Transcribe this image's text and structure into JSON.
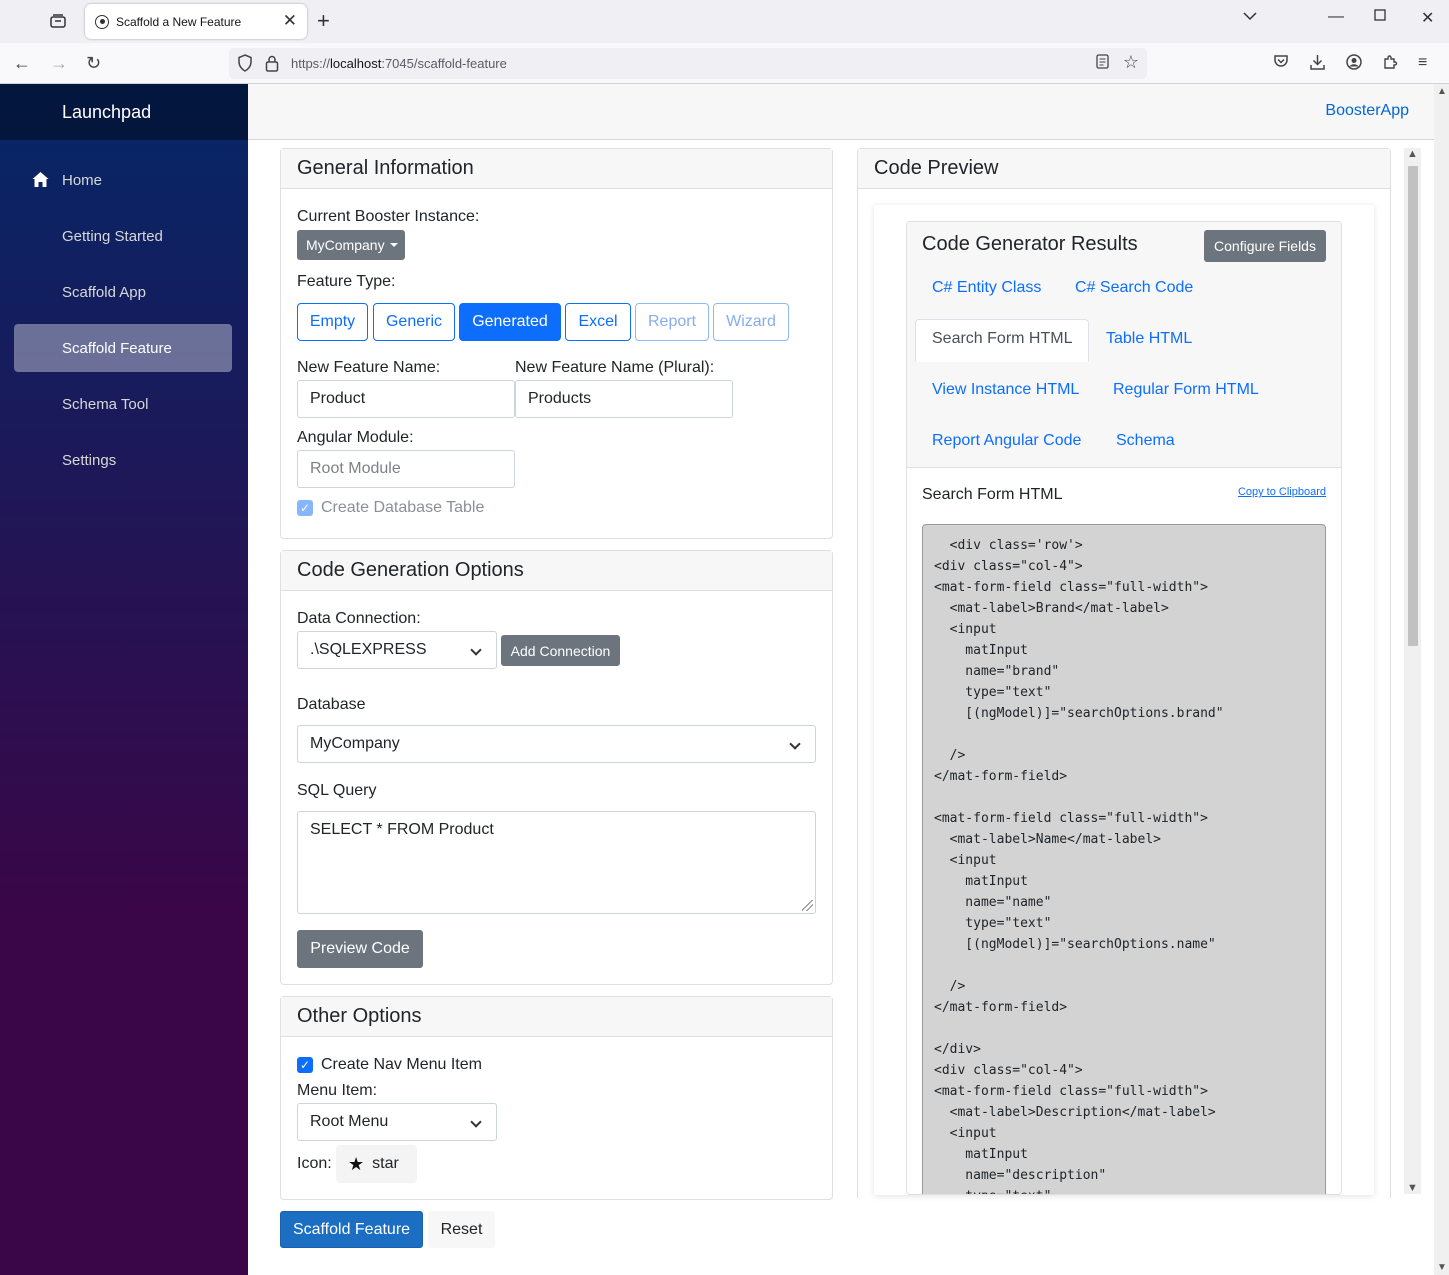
{
  "browser": {
    "tab_title": "Scaffold a New Feature",
    "url_prefix": "https://",
    "url_host": "localhost",
    "url_rest": ":7045/scaffold-feature"
  },
  "sidebar": {
    "brand": "Launchpad",
    "items": [
      {
        "label": "Home",
        "icon": "home-icon"
      },
      {
        "label": "Getting Started"
      },
      {
        "label": "Scaffold App"
      },
      {
        "label": "Scaffold Feature",
        "active": true
      },
      {
        "label": "Schema Tool"
      },
      {
        "label": "Settings"
      }
    ]
  },
  "top_row": {
    "brand_link": "BoosterApp"
  },
  "general": {
    "header": "General Information",
    "instance_label": "Current Booster Instance:",
    "instance_value": "MyCompany",
    "feature_type_label": "Feature Type:",
    "feature_types": [
      "Empty",
      "Generic",
      "Generated",
      "Excel",
      "Report",
      "Wizard"
    ],
    "selected_feature_type": "Generated",
    "name_label": "New Feature Name:",
    "name_value": "Product",
    "plural_label": "New Feature Name (Plural):",
    "plural_value": "Products",
    "module_label": "Angular Module:",
    "module_placeholder": "Root Module",
    "create_table_label": "Create Database Table",
    "create_table_checked": true
  },
  "codegen": {
    "header": "Code Generation Options",
    "connection_label": "Data Connection:",
    "connection_value": ".\\SQLEXPRESS",
    "add_connection": "Add Connection",
    "database_label": "Database",
    "database_value": "MyCompany",
    "sql_label": "SQL Query",
    "sql_value": "SELECT * FROM Product",
    "preview_button": "Preview Code"
  },
  "other": {
    "header": "Other Options",
    "nav_item_label": "Create Nav Menu Item",
    "nav_item_checked": true,
    "menu_item_label": "Menu Item:",
    "menu_item_value": "Root Menu",
    "icon_label": "Icon:",
    "icon_value": "star",
    "icon_glyph": "star-icon"
  },
  "actions": {
    "scaffold": "Scaffold Feature",
    "reset": "Reset"
  },
  "preview": {
    "header": "Code Preview",
    "results_title": "Code Generator Results",
    "configure_fields": "Configure Fields",
    "tabs": [
      "C# Entity Class",
      "C# Search Code",
      "Search Form HTML",
      "Table HTML",
      "View Instance HTML",
      "Regular Form HTML",
      "Report Angular Code",
      "Schema"
    ],
    "active_tab": "Search Form HTML",
    "code_title": "Search Form HTML",
    "copy_link": "Copy to Clipboard",
    "code": "  <div class='row'>\n<div class=\"col-4\">\n<mat-form-field class=\"full-width\">\n  <mat-label>Brand</mat-label>\n  <input\n    matInput\n    name=\"brand\"\n    type=\"text\"\n    [(ngModel)]=\"searchOptions.brand\"\n\n  />\n</mat-form-field>\n\n<mat-form-field class=\"full-width\">\n  <mat-label>Name</mat-label>\n  <input\n    matInput\n    name=\"name\"\n    type=\"text\"\n    [(ngModel)]=\"searchOptions.name\"\n\n  />\n</mat-form-field>\n\n</div>\n<div class=\"col-4\">\n<mat-form-field class=\"full-width\">\n  <mat-label>Description</mat-label>\n  <input\n    matInput\n    name=\"description\"\n    type=\"text\""
  },
  "colors": {
    "primary": "#0d6efd",
    "scaffold_button": "#1b6ec2",
    "secondary_button": "#6c757d",
    "sidebar_top": "#052767",
    "sidebar_bottom": "#3a0647"
  }
}
